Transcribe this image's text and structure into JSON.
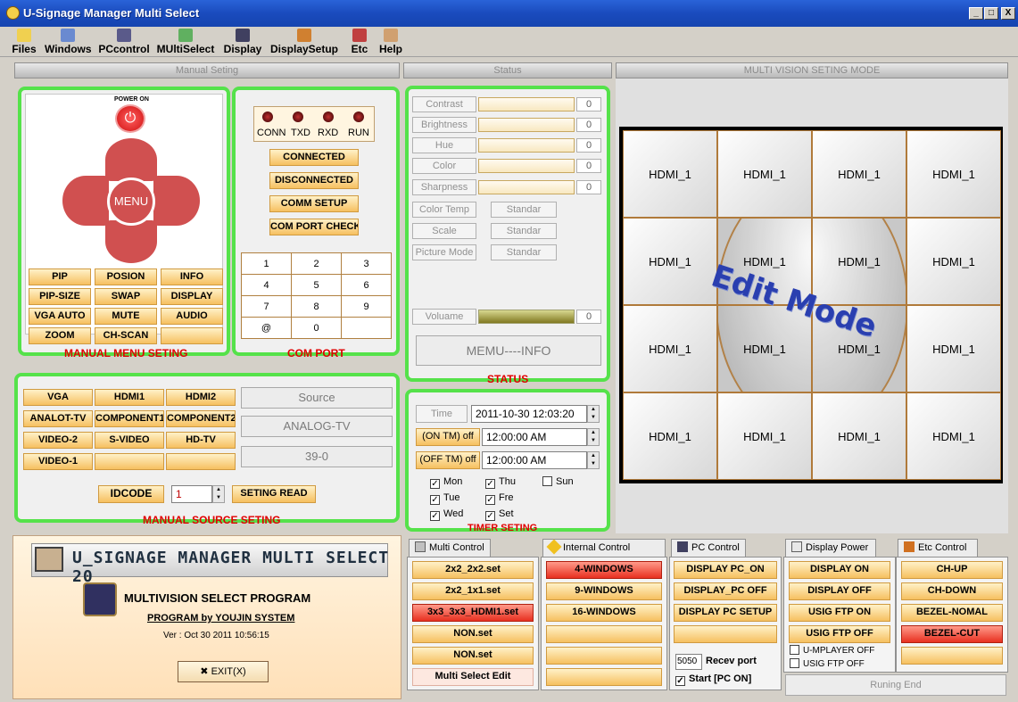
{
  "window": {
    "title": "U-Signage Manager Multi Select",
    "min": "_",
    "max": "□",
    "close": "X"
  },
  "menu": [
    "Files",
    "Windows",
    "PCcontrol",
    "MUltiSelect",
    "Display",
    "DisplaySetup",
    "Etc",
    "Help"
  ],
  "manual": {
    "header": "Manual Seting",
    "power_label": "POWER ON",
    "menu_label": "MENU",
    "buttons": [
      "PIP",
      "POSION",
      "INFO",
      "PIP-SIZE",
      "SWAP",
      "DISPLAY",
      "VGA AUTO",
      "MUTE",
      "AUDIO",
      "ZOOM",
      "CH-SCAN",
      ""
    ],
    "caption": "MANUAL MENU  SETING"
  },
  "com": {
    "leds": [
      "CONN",
      "TXD",
      "RXD",
      "RUN"
    ],
    "buttons": [
      "CONNECTED",
      "DISCONNECTED",
      "COMM SETUP",
      "COM PORT CHECK"
    ],
    "keypad": [
      "1",
      "2",
      "3",
      "4",
      "5",
      "6",
      "7",
      "8",
      "9",
      "@",
      "0",
      ""
    ],
    "caption": "COM PORT"
  },
  "status": {
    "header": "Status",
    "sliders": [
      {
        "label": "Contrast",
        "value": "0"
      },
      {
        "label": "Brightness",
        "value": "0"
      },
      {
        "label": "Hue",
        "value": "0"
      },
      {
        "label": "Color",
        "value": "0"
      },
      {
        "label": "Sharpness",
        "value": "0"
      }
    ],
    "modes": [
      {
        "label": "Color Temp",
        "value": "Standar"
      },
      {
        "label": "Scale",
        "value": "Standar"
      },
      {
        "label": "Picture Mode",
        "value": "Standar"
      }
    ],
    "volume": {
      "label": "Voluame",
      "value": "0"
    },
    "info_button": "MEMU----INFO",
    "caption": "STATUS"
  },
  "source": {
    "buttons": [
      "VGA",
      "HDMI1",
      "HDMI2",
      "ANALOT-TV",
      "COMPONENT1",
      "COMPONENT2",
      "VIDEO-2",
      "S-VIDEO",
      "HD-TV",
      "VIDEO-1",
      "",
      ""
    ],
    "displays": [
      "Source",
      "ANALOG-TV",
      "39-0"
    ],
    "idcode_label": "IDCODE",
    "idcode_value": "1",
    "read_button": "SETING READ",
    "caption": "MANUAL SOURCE SETING"
  },
  "timer": {
    "time_label": "Time",
    "time_value": "2011-10-30  12:03:20",
    "on_label": "(ON  TM) off",
    "on_value": "12:00:00 AM",
    "off_label": "(OFF TM) off",
    "off_value": "12:00:00 AM",
    "days": [
      {
        "name": "Mon",
        "checked": "✓"
      },
      {
        "name": "Thu",
        "checked": "✓"
      },
      {
        "name": "Sun",
        "checked": ""
      },
      {
        "name": "Tue",
        "checked": "✓"
      },
      {
        "name": "Fre",
        "checked": "✓"
      },
      {
        "name": "Wed",
        "checked": "✓"
      },
      {
        "name": "Set",
        "checked": "✓"
      }
    ],
    "caption": "TIMER SETING"
  },
  "multivision": {
    "header": "MULTI VISION SETING MODE",
    "cells": [
      "HDMI_1",
      "HDMI_1",
      "HDMI_1",
      "HDMI_1",
      "HDMI_1",
      "HDMI_1",
      "HDMI_1",
      "HDMI_1",
      "HDMI_1",
      "HDMI_1",
      "HDMI_1",
      "HDMI_1",
      "HDMI_1",
      "HDMI_1",
      "HDMI_1",
      "HDMI_1"
    ],
    "overlay": "Edit Mode"
  },
  "about": {
    "banner": "U_SIGNAGE MANAGER MULTI SELECT 20",
    "subtitle": "MULTIVISION  SELECT PROGRAM",
    "by": "PROGRAM by YOUJIN SYSTEM",
    "ver": "Ver :  Oct 30 2011   10:56:15",
    "exit": "EXIT(X)"
  },
  "tabs": {
    "multi": {
      "title": "Multi  Control",
      "buttons": [
        "2x2_2x2.set",
        "2x2_1x1.set",
        "3x3_3x3_HDMI1.set",
        "NON.set",
        "NON.set",
        "Multi Select Edit"
      ]
    },
    "internal": {
      "title": "Internal Control",
      "buttons": [
        "4-WINDOWS",
        "9-WINDOWS",
        "16-WINDOWS",
        "",
        "",
        ""
      ]
    },
    "pc": {
      "title": "PC Control",
      "buttons": [
        "DISPLAY PC_ON",
        "DISPLAY_PC OFF",
        "DISPLAY PC SETUP",
        ""
      ],
      "port_value": "5050",
      "port_label": "Recev port",
      "start_label": "Start  [PC ON]"
    },
    "power": {
      "title": "Display Power",
      "buttons": [
        "DISPLAY    ON",
        "DISPLAY    OFF",
        "USIG FTP ON",
        "USIG FTP OFF"
      ],
      "checks": [
        "U-MPLAYER OFF",
        "USIG FTP OFF"
      ],
      "run_end": "Runing End"
    },
    "etc": {
      "title": "Etc Control",
      "buttons": [
        "CH-UP",
        "CH-DOWN",
        "BEZEL-NOMAL",
        "BEZEL-CUT",
        ""
      ]
    }
  }
}
